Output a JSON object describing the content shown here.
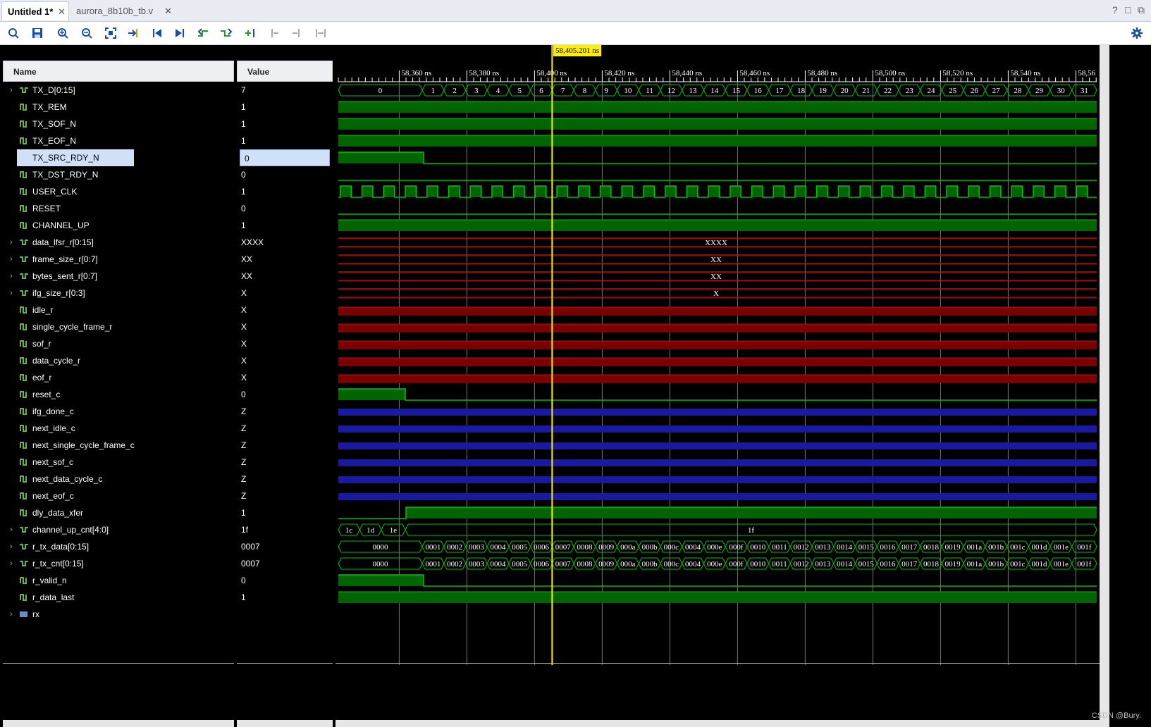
{
  "tabs": [
    {
      "label": "Untitled 1*",
      "active": true
    },
    {
      "label": "aurora_8b10b_tb.v",
      "active": false
    }
  ],
  "window_controls": [
    "?",
    "□",
    "⧉"
  ],
  "toolbar_icons": [
    "search-icon",
    "save-icon",
    "zoom-in-icon",
    "zoom-out-icon",
    "zoom-fit-icon",
    "go-to-cursor-icon",
    "go-to-start-icon",
    "go-to-end-icon",
    "previous-transition-icon",
    "next-transition-icon",
    "add-marker-icon",
    "previous-marker-icon",
    "next-marker-icon",
    "swap-cursors-icon",
    "settings-gear-icon"
  ],
  "columns": {
    "name": "Name",
    "value": "Value"
  },
  "cursor": {
    "label": "58,405.201 ns"
  },
  "timeline": {
    "ticks": [
      "58,360 ns",
      "58,380 ns",
      "58,400 ns",
      "58,420 ns",
      "58,440 ns",
      "58,460 ns",
      "58,480 ns",
      "58,500 ns",
      "58,520 ns",
      "58,540 ns",
      "58,56"
    ]
  },
  "signals": [
    {
      "name": "TX_D[0:15]",
      "value": "7",
      "bus": true,
      "expand": true,
      "color": "green",
      "kind": "counter"
    },
    {
      "name": "TX_REM",
      "value": "1",
      "bus": false,
      "color": "green",
      "kind": "high"
    },
    {
      "name": "TX_SOF_N",
      "value": "1",
      "bus": false,
      "color": "green",
      "kind": "high"
    },
    {
      "name": "TX_EOF_N",
      "value": "1",
      "bus": false,
      "color": "green",
      "kind": "high"
    },
    {
      "name": "TX_SRC_RDY_N",
      "value": "0",
      "bus": false,
      "color": "green",
      "kind": "fall1",
      "selected": true
    },
    {
      "name": "TX_DST_RDY_N",
      "value": "0",
      "bus": false,
      "color": "green",
      "kind": "low"
    },
    {
      "name": "USER_CLK",
      "value": "1",
      "bus": false,
      "color": "green",
      "kind": "clock"
    },
    {
      "name": "RESET",
      "value": "0",
      "bus": false,
      "color": "green",
      "kind": "low"
    },
    {
      "name": "CHANNEL_UP",
      "value": "1",
      "bus": false,
      "color": "green",
      "kind": "high"
    },
    {
      "name": "data_lfsr_r[0:15]",
      "value": "XXXX",
      "bus": true,
      "expand": true,
      "color": "red",
      "kind": "xbus",
      "text": "XXXX"
    },
    {
      "name": "frame_size_r[0:7]",
      "value": "XX",
      "bus": true,
      "expand": true,
      "color": "red",
      "kind": "xbus",
      "text": "XX"
    },
    {
      "name": "bytes_sent_r[0:7]",
      "value": "XX",
      "bus": true,
      "expand": true,
      "color": "red",
      "kind": "xbus",
      "text": "XX"
    },
    {
      "name": "ifg_size_r[0:3]",
      "value": "X",
      "bus": true,
      "expand": true,
      "color": "red",
      "kind": "xbus",
      "text": "X"
    },
    {
      "name": "idle_r",
      "value": "X",
      "bus": false,
      "color": "red",
      "kind": "xbit"
    },
    {
      "name": "single_cycle_frame_r",
      "value": "X",
      "bus": false,
      "color": "red",
      "kind": "xbit"
    },
    {
      "name": "sof_r",
      "value": "X",
      "bus": false,
      "color": "red",
      "kind": "xbit"
    },
    {
      "name": "data_cycle_r",
      "value": "X",
      "bus": false,
      "color": "red",
      "kind": "xbit"
    },
    {
      "name": "eof_r",
      "value": "X",
      "bus": false,
      "color": "red",
      "kind": "xbit"
    },
    {
      "name": "reset_c",
      "value": "0",
      "bus": false,
      "color": "green",
      "kind": "fall2"
    },
    {
      "name": "ifg_done_c",
      "value": "Z",
      "bus": false,
      "color": "blue",
      "kind": "zbit"
    },
    {
      "name": "next_idle_c",
      "value": "Z",
      "bus": false,
      "color": "blue",
      "kind": "zbit"
    },
    {
      "name": "next_single_cycle_frame_c",
      "value": "Z",
      "bus": false,
      "color": "blue",
      "kind": "zbit"
    },
    {
      "name": "next_sof_c",
      "value": "Z",
      "bus": false,
      "color": "blue",
      "kind": "zbit"
    },
    {
      "name": "next_data_cycle_c",
      "value": "Z",
      "bus": false,
      "color": "blue",
      "kind": "zbit"
    },
    {
      "name": "next_eof_c",
      "value": "Z",
      "bus": false,
      "color": "blue",
      "kind": "zbit"
    },
    {
      "name": "dly_data_xfer",
      "value": "1",
      "bus": false,
      "color": "green",
      "kind": "rise2"
    },
    {
      "name": "channel_up_cnt[4:0]",
      "value": "1f",
      "bus": true,
      "expand": true,
      "color": "green",
      "kind": "chcnt"
    },
    {
      "name": "r_tx_data[0:15]",
      "value": "0007",
      "bus": true,
      "expand": true,
      "color": "green",
      "kind": "hexcount"
    },
    {
      "name": "r_tx_cnt[0:15]",
      "value": "0007",
      "bus": true,
      "expand": true,
      "color": "green",
      "kind": "hexcount"
    },
    {
      "name": "r_valid_n",
      "value": "0",
      "bus": false,
      "color": "green",
      "kind": "fall1"
    },
    {
      "name": "r_data_last",
      "value": "1",
      "bus": false,
      "color": "green",
      "kind": "high"
    },
    {
      "name": "rx",
      "value": "",
      "bus": true,
      "expand": true,
      "color": "none",
      "kind": "none",
      "group": true
    }
  ],
  "bus_values": {
    "tx_d": [
      "0",
      "1",
      "2",
      "3",
      "4",
      "5",
      "6",
      "7",
      "8",
      "9",
      "10",
      "11",
      "12",
      "13",
      "14",
      "15",
      "16",
      "17",
      "18",
      "19",
      "20",
      "21",
      "22",
      "23",
      "24",
      "25",
      "26",
      "27",
      "28",
      "29",
      "30",
      "31"
    ],
    "channel_up_cnt": [
      "1c",
      "1d",
      "1e",
      "1f"
    ],
    "hex": [
      "0000",
      "0001",
      "0002",
      "0003",
      "0004",
      "0005",
      "0006",
      "0007",
      "0008",
      "0009",
      "000a",
      "000b",
      "000c",
      "0004",
      "000e",
      "000f",
      "0010",
      "0011",
      "0012",
      "0013",
      "0014",
      "0015",
      "0016",
      "0017",
      "0018",
      "0019",
      "001a",
      "001b",
      "001c",
      "001d",
      "001e",
      "001f"
    ]
  },
  "colors": {
    "green": "#00c000",
    "fill_green": "#006400",
    "red": "#e00000",
    "fill_red": "#7a0000",
    "blue": "#1a1aa0",
    "cursor": "#ffee00",
    "grid": "#777777"
  },
  "credit": "CSDN @Bury."
}
